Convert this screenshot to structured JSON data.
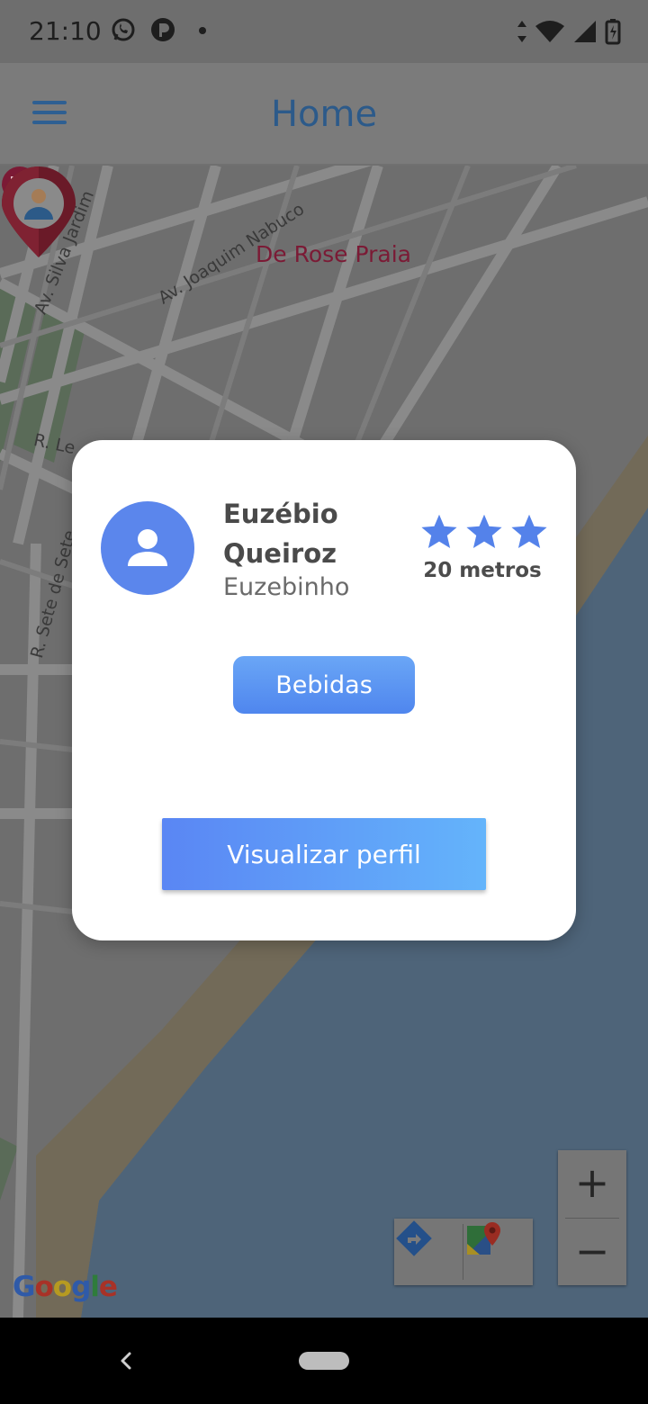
{
  "status_bar": {
    "time": "21:10"
  },
  "header": {
    "title": "Home"
  },
  "map": {
    "streets": [
      "Av. Silva Jardim",
      "Av. Joaquim Nabuco",
      "R. Le",
      "R. Sete de Sete"
    ],
    "poi": "De Rose Praia",
    "attribution": {
      "letters": [
        "G",
        "o",
        "o",
        "g",
        "l",
        "e"
      ],
      "colors": [
        "#2f5aa8",
        "#a83227",
        "#b69a21",
        "#2f5aa8",
        "#2f7c3b",
        "#a83227"
      ]
    },
    "zoom_in": "+",
    "zoom_out": "−"
  },
  "dialog": {
    "name": "Euzébio Queiroz",
    "nickname": "Euzebinho",
    "rating": 3,
    "distance": "20 metros",
    "tag_label": "Bebidas",
    "profile_button": "Visualizar perfil",
    "accent": "#5b86ec"
  }
}
